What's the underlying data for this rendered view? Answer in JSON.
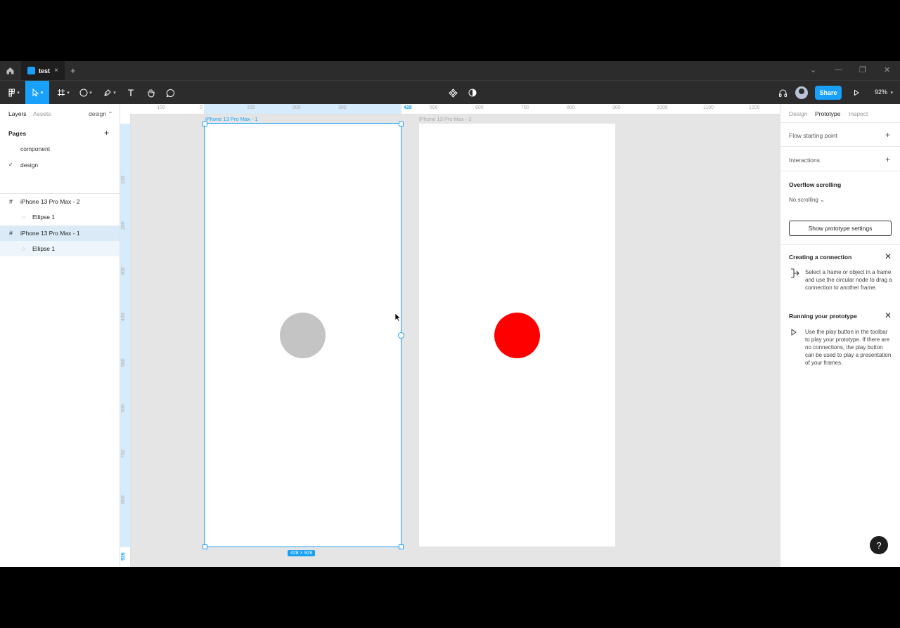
{
  "tab": {
    "name": "test",
    "close": "×"
  },
  "titlebar": {
    "new_tab": "+",
    "min": "—",
    "restore": "❐",
    "close": "✕",
    "chevron": "⌄"
  },
  "toolbar": {
    "share_label": "Share",
    "zoom": "92%",
    "text_tool": "T"
  },
  "left_panel": {
    "tabs": {
      "layers": "Layers",
      "assets": "Assets",
      "page": "design ⌃"
    },
    "pages_title": "Pages",
    "add_page": "+",
    "pages": [
      {
        "name": "component",
        "current": false
      },
      {
        "name": "design",
        "current": true
      }
    ],
    "layers": [
      {
        "name": "iPhone 13 Pro Max - 2",
        "type": "frame"
      },
      {
        "name": "Ellipse 1",
        "type": "ellipse"
      },
      {
        "name": "iPhone 13 Pro Max - 1",
        "type": "frame"
      },
      {
        "name": "Ellipse 1",
        "type": "ellipse"
      }
    ],
    "check_mark": "✓",
    "frame_glyph": "#",
    "ellipse_glyph": "○"
  },
  "rulers": {
    "top": [
      "-100",
      "0",
      "100",
      "200",
      "300",
      "428",
      "500",
      "600",
      "700",
      "800",
      "900",
      "1000",
      "1100",
      "1200"
    ],
    "left": [
      "100",
      "200",
      "300",
      "400",
      "500",
      "600",
      "700",
      "800",
      "926"
    ]
  },
  "canvas": {
    "frame1_label": "iPhone 13 Pro Max - 1",
    "frame2_label": "iPhone 13 Pro Max - 2",
    "dimensions": "428 × 926",
    "ellipse1_color": "#c4c4c4",
    "ellipse2_color": "#ff0000"
  },
  "right_panel": {
    "tabs": {
      "design": "Design",
      "prototype": "Prototype",
      "inspect": "Inspect"
    },
    "flow_starting_point": "Flow starting point",
    "interactions": "Interactions",
    "overflow_title": "Overflow scrolling",
    "overflow_value": "No scrolling ⌄",
    "show_settings": "Show prototype settings",
    "tip1_title": "Creating a connection",
    "tip1_body": "Select a frame or object in a frame and use the circular node to drag a connection to another frame.",
    "tip2_title": "Running your prototype",
    "tip2_body": "Use the play button in the toolbar to play your prototype. If there are no connections, the play button can be used to play a presentation of your frames.",
    "plus": "+",
    "close": "✕"
  },
  "help": "?",
  "colors": {
    "accent": "#18a0fb",
    "toolbar": "#2c2c2c"
  }
}
